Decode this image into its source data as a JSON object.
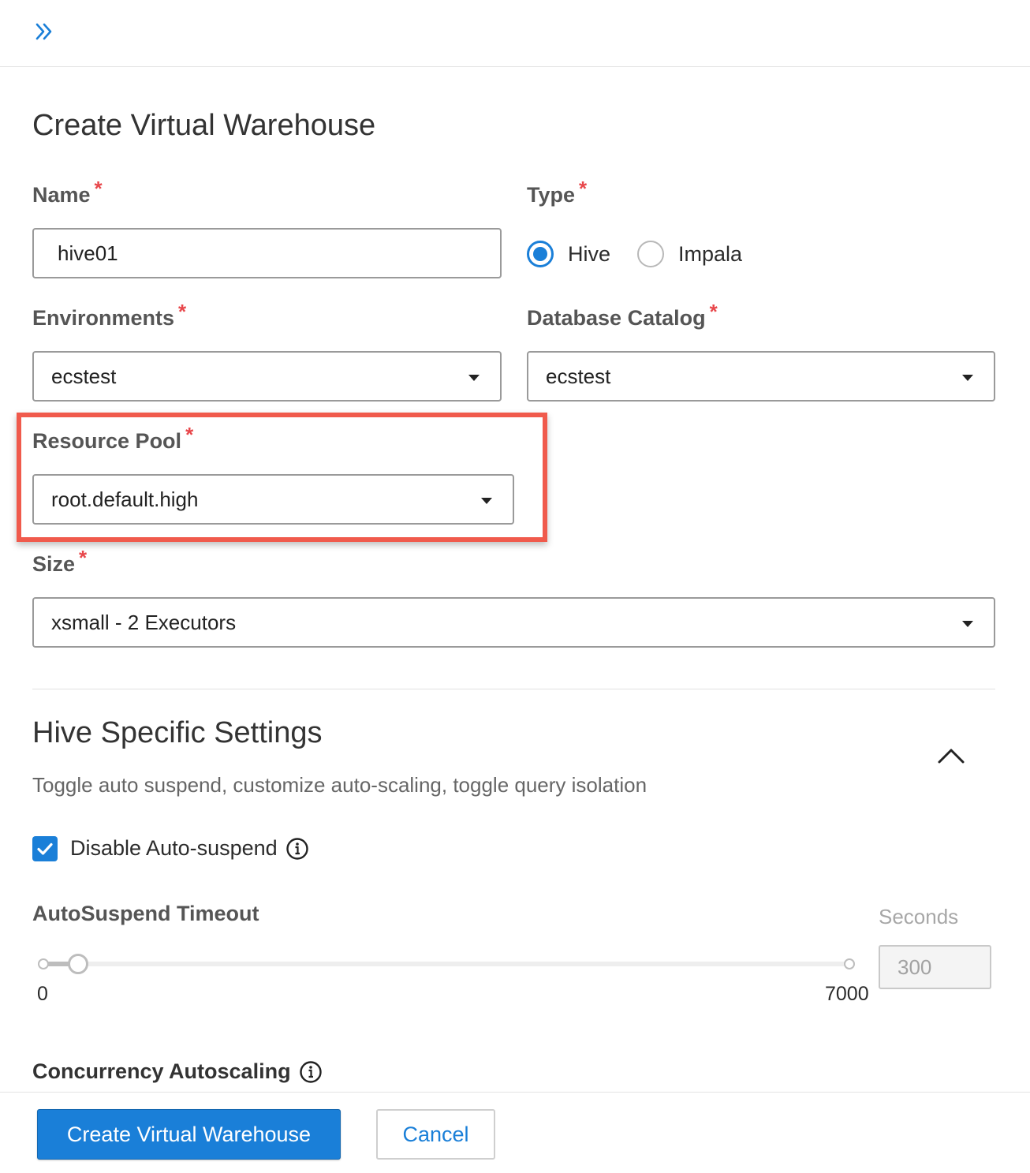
{
  "header": {
    "expand_icon": "double-chevron-right-icon"
  },
  "form": {
    "title": "Create Virtual Warehouse",
    "required_marker": "*",
    "name": {
      "label": "Name",
      "value": "hive01"
    },
    "type": {
      "label": "Type",
      "options": [
        {
          "label": "Hive",
          "selected": true
        },
        {
          "label": "Impala",
          "selected": false
        }
      ]
    },
    "environments": {
      "label": "Environments",
      "value": "ecstest"
    },
    "database_catalog": {
      "label": "Database Catalog",
      "value": "ecstest"
    },
    "resource_pool": {
      "label": "Resource Pool",
      "value": "root.default.high",
      "highlighted": true
    },
    "size": {
      "label": "Size",
      "value": "xsmall - 2 Executors"
    }
  },
  "hive_settings": {
    "title": "Hive Specific Settings",
    "description": "Toggle auto suspend, customize auto-scaling, toggle query isolation",
    "collapse_icon": "chevron-up-icon",
    "disable_auto_suspend": {
      "label": "Disable Auto-suspend",
      "checked": true
    },
    "autosuspend_timeout": {
      "label": "AutoSuspend Timeout",
      "unit_label": "Seconds",
      "min": "0",
      "max": "7000",
      "value": "300"
    },
    "concurrency_autoscaling": {
      "label": "Concurrency Autoscaling"
    }
  },
  "footer": {
    "create_label": "Create Virtual Warehouse",
    "cancel_label": "Cancel"
  },
  "colors": {
    "accent": "#1a7fd8",
    "required": "#e8474b",
    "highlight_border": "#f05a4c"
  }
}
